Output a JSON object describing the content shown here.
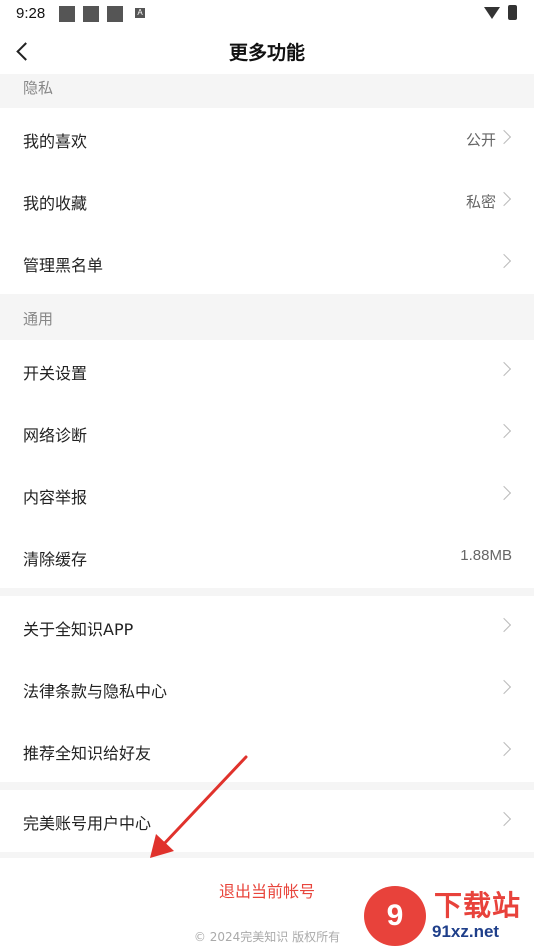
{
  "status_bar": {
    "time": "9:28",
    "notification_icon_letter": "A"
  },
  "header": {
    "title": "更多功能"
  },
  "privacy": {
    "section_label": "隐私",
    "items": [
      {
        "label": "我的喜欢",
        "value": "公开"
      },
      {
        "label": "我的收藏",
        "value": "私密"
      },
      {
        "label": "管理黑名单",
        "value": ""
      }
    ]
  },
  "general": {
    "section_label": "通用",
    "items": [
      {
        "label": "开关设置",
        "value": ""
      },
      {
        "label": "网络诊断",
        "value": ""
      },
      {
        "label": "内容举报",
        "value": ""
      },
      {
        "label": "清除缓存",
        "value": "1.88MB"
      }
    ]
  },
  "about": {
    "items": [
      {
        "label": "关于全知识APP"
      },
      {
        "label": "法律条款与隐私中心"
      },
      {
        "label": "推荐全知识给好友"
      }
    ]
  },
  "account": {
    "items": [
      {
        "label": "完美账号用户中心"
      }
    ]
  },
  "footer": {
    "logout_label": "退出当前帐号",
    "copyright": "© 2024完美知识 版权所有"
  },
  "watermark": {
    "badge": "9",
    "cn_text": "下载站",
    "en_text": "91xz.net"
  },
  "colors": {
    "logout_red": "#e8453c",
    "annotation_arrow": "#e0322c",
    "watermark_red": "#e8423b",
    "watermark_blue": "#1f3f8a"
  }
}
